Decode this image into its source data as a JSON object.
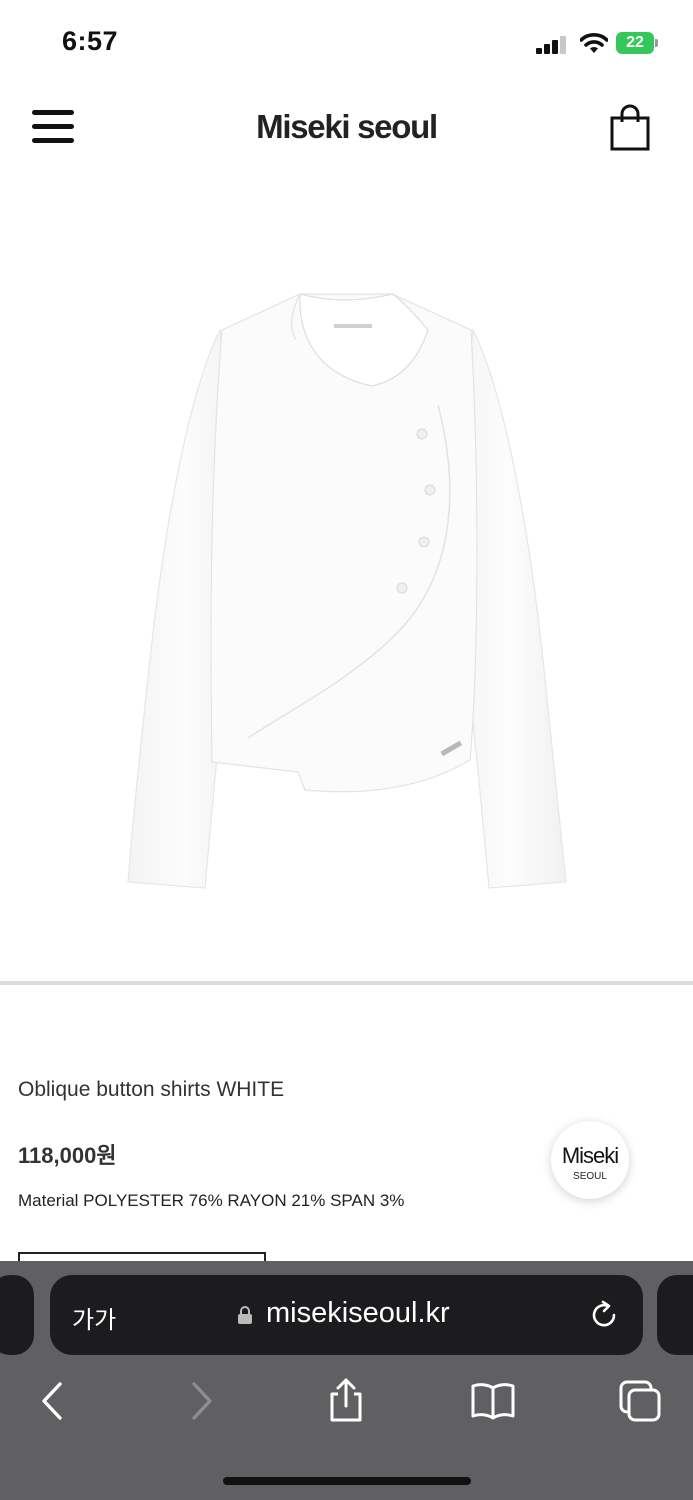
{
  "status_bar": {
    "time": "6:57",
    "battery": "22"
  },
  "header": {
    "logo": "Miseki seoul"
  },
  "product": {
    "name": "Oblique button shirts WHITE",
    "price": "118,000원",
    "material": "Material POLYESTER 76% RAYON 21% SPAN 3%"
  },
  "badge": {
    "main": "Miseki",
    "sub": "SEOUL"
  },
  "browser": {
    "text_size_label": "가가",
    "url": "misekiseoul.kr"
  },
  "icons": {
    "menu": "hamburger-icon",
    "cart": "shopping-bag-icon",
    "lock": "lock-icon",
    "reload": "reload-icon",
    "back": "chevron-left-icon",
    "forward": "chevron-right-icon",
    "share": "share-icon",
    "bookmarks": "book-icon",
    "tabs": "tabs-icon"
  },
  "colors": {
    "battery": "#35c759",
    "browser_bg": "#606062",
    "url_bar_bg": "#1c1c1e"
  }
}
